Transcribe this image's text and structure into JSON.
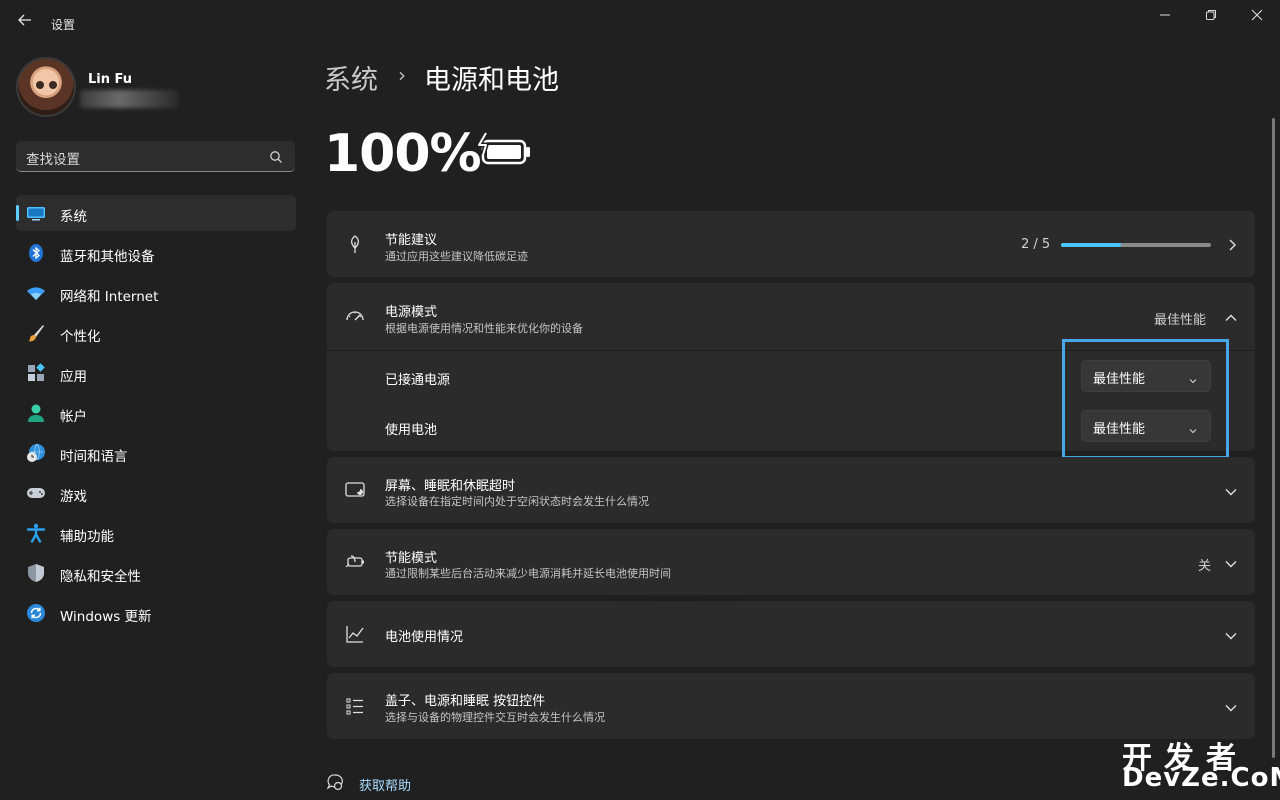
{
  "window": {
    "title": "设置",
    "back_icon": "arrow-left",
    "controls": {
      "minimize": "minimize-icon",
      "maximize": "restore-icon",
      "close": "close-icon"
    }
  },
  "user": {
    "name": "Lin Fu"
  },
  "search": {
    "placeholder": "查找设置",
    "icon": "search-icon"
  },
  "sidebar": {
    "items": [
      {
        "label": "系统",
        "icon": "system-icon",
        "selected": true
      },
      {
        "label": "蓝牙和其他设备",
        "icon": "bluetooth-icon",
        "selected": false
      },
      {
        "label": "网络和 Internet",
        "icon": "wifi-icon",
        "selected": false
      },
      {
        "label": "个性化",
        "icon": "brush-icon",
        "selected": false
      },
      {
        "label": "应用",
        "icon": "apps-icon",
        "selected": false
      },
      {
        "label": "帐户",
        "icon": "person-icon",
        "selected": false
      },
      {
        "label": "时间和语言",
        "icon": "globe-clock-icon",
        "selected": false
      },
      {
        "label": "游戏",
        "icon": "gamepad-icon",
        "selected": false
      },
      {
        "label": "辅助功能",
        "icon": "accessibility-icon",
        "selected": false
      },
      {
        "label": "隐私和安全性",
        "icon": "shield-icon",
        "selected": false
      },
      {
        "label": "Windows 更新",
        "icon": "update-icon",
        "selected": false
      }
    ]
  },
  "breadcrumb": {
    "parent": "系统",
    "separator": "›",
    "current": "电源和电池"
  },
  "battery": {
    "percent_text": "100%",
    "icon": "battery-charging-icon"
  },
  "cards": {
    "energy": {
      "title": "节能建议",
      "subtitle": "通过应用这些建议降低碳足迹",
      "progress_text": "2 / 5",
      "progress_fraction": 0.4,
      "icon": "leaf-icon"
    },
    "power_mode": {
      "title": "电源模式",
      "subtitle": "根据电源使用情况和性能来优化你的设备",
      "state": "最佳性能",
      "icon": "gauge-icon",
      "rows": [
        {
          "label": "已接通电源",
          "value": "最佳性能"
        },
        {
          "label": "使用电池",
          "value": "最佳性能"
        }
      ]
    },
    "screen_sleep": {
      "title": "屏幕、睡眠和休眠超时",
      "subtitle": "选择设备在指定时间内处于空闲状态时会发生什么情况",
      "icon": "screen-sleep-icon"
    },
    "saver": {
      "title": "节能模式",
      "subtitle": "通过限制某些后台活动来减少电源消耗并延长电池使用时间",
      "state": "关",
      "icon": "battery-saver-icon"
    },
    "usage": {
      "title": "电池使用情况",
      "icon": "chart-line-icon"
    },
    "lid": {
      "title": "盖子、电源和睡眠 按钮控件",
      "subtitle": "选择与设备的物理控件交互时会发生什么情况",
      "icon": "list-icon"
    }
  },
  "help": {
    "label": "获取帮助",
    "icon": "help-icon"
  },
  "watermark": {
    "line1": "开发者",
    "line2": "DevZe.CoM"
  },
  "colors": {
    "background": "#202020",
    "card": "#2b2b2b",
    "accent": "#4cc2ff",
    "highlight": "#4aa8e8"
  }
}
